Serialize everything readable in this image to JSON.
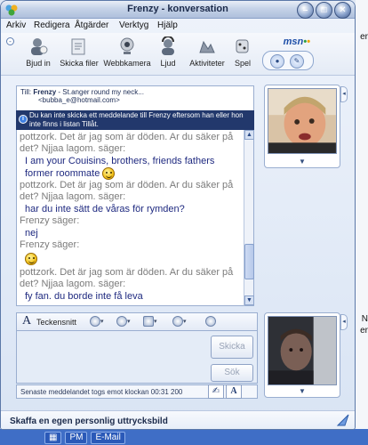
{
  "window": {
    "title": "Frenzy - konversation",
    "controls": {
      "minimize": "–",
      "maximize": "□",
      "close": "✕"
    }
  },
  "menu": [
    {
      "label": "Arkiv"
    },
    {
      "label": "Redigera"
    },
    {
      "label": "Åtgärder"
    },
    {
      "label": "Verktyg"
    },
    {
      "label": "Hjälp"
    }
  ],
  "toolbar": {
    "items": [
      {
        "label": "Bjud in",
        "icon": "invite-icon"
      },
      {
        "label": "Skicka filer",
        "icon": "send-files-icon"
      },
      {
        "label": "Webbkamera",
        "icon": "webcam-icon"
      },
      {
        "label": "Ljud",
        "icon": "audio-icon"
      },
      {
        "label": "Aktiviteter",
        "icon": "activities-icon"
      },
      {
        "label": "Spel",
        "icon": "games-icon"
      }
    ],
    "logo": "msn"
  },
  "conversation": {
    "to_label": "Till:",
    "contact_name": "Frenzy",
    "contact_status": "- St.anger round my neck...",
    "contact_email": "<bubba_e@hotmail.com>",
    "info_text": "Du kan inte skicka ett meddelande till Frenzy eftersom han eller hon inte finns i listan Tillåt.",
    "messages": [
      {
        "sys": "pottzork. Det är jag som är döden. Ar du säker på det? Njjaa lagom. säger:",
        "text": "I am your Couisins, brothers, friends fathers former roommate",
        "emoticon": true
      },
      {
        "sys": "pottzork. Det är jag som är döden. Ar du säker på det? Njjaa lagom. säger:",
        "text": "har du inte sätt de våras för rymden?",
        "emoticon": false
      },
      {
        "sys": "Frenzy säger:",
        "text": "nej",
        "emoticon": false
      },
      {
        "sys": "Frenzy säger:",
        "text": "",
        "emoticon": true
      },
      {
        "sys": "pottzork. Det är jag som är döden. Ar du säker på det? Njjaa lagom. säger:",
        "text": "fy fan. du borde inte få leva",
        "emoticon": false
      }
    ]
  },
  "compose": {
    "font_label": "Teckensnitt",
    "send_label": "Skicka",
    "search_label": "Sök",
    "status_text": "Senaste meddelandet togs emot klockan 00:31 200"
  },
  "bottom": {
    "text": "Skaffa en egen personlig uttrycksbild"
  },
  "background": {
    "taskbar_items": [
      "PM",
      "E-Mail"
    ],
    "right_edge_text": [
      "er",
      "N",
      "er"
    ]
  }
}
